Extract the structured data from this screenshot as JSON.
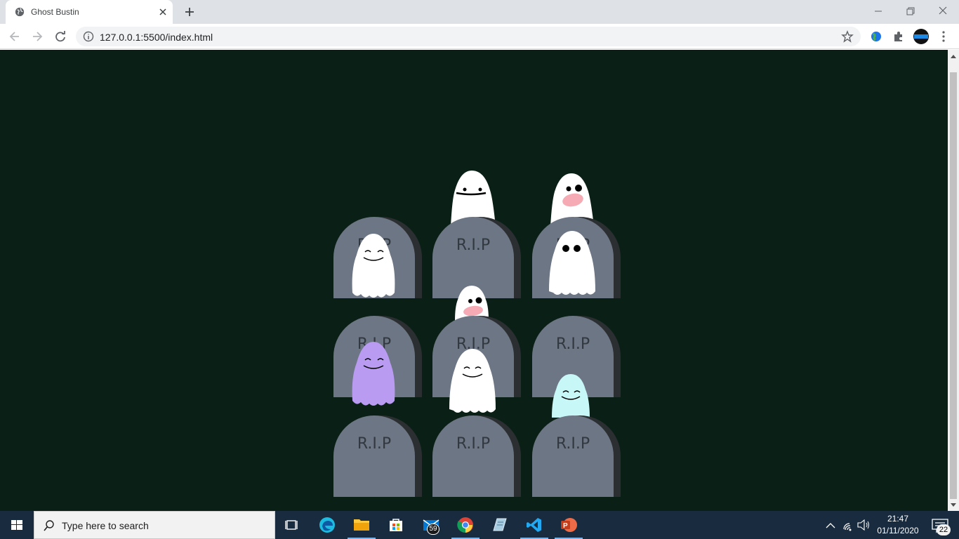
{
  "browser": {
    "tab_title": "Ghost Bustin",
    "url": "127.0.0.1:5500/index.html"
  },
  "page": {
    "background": "#0a2016",
    "tombstone_label": "R.I.P",
    "tombstone_labels": [
      "R.I.P",
      "R.I.P",
      "R.I.P",
      "R.I.P",
      "R.I.P",
      "R.I.P",
      "R.I.P",
      "R.I.P",
      "R.I.P"
    ],
    "ghost_colors": {
      "white": "#ffffff",
      "purple": "#b99cf2",
      "cyan": "#c8f7f7",
      "tongue": "#f5aab4"
    }
  },
  "taskbar": {
    "search_placeholder": "Type here to search",
    "mail_badge": "59",
    "time": "21:47",
    "date": "01/11/2020",
    "notifications": "22",
    "apps": [
      "task-view",
      "edge",
      "file-explorer",
      "microsoft-store",
      "mail",
      "chrome",
      "notepad",
      "vscode",
      "powerpoint"
    ]
  }
}
